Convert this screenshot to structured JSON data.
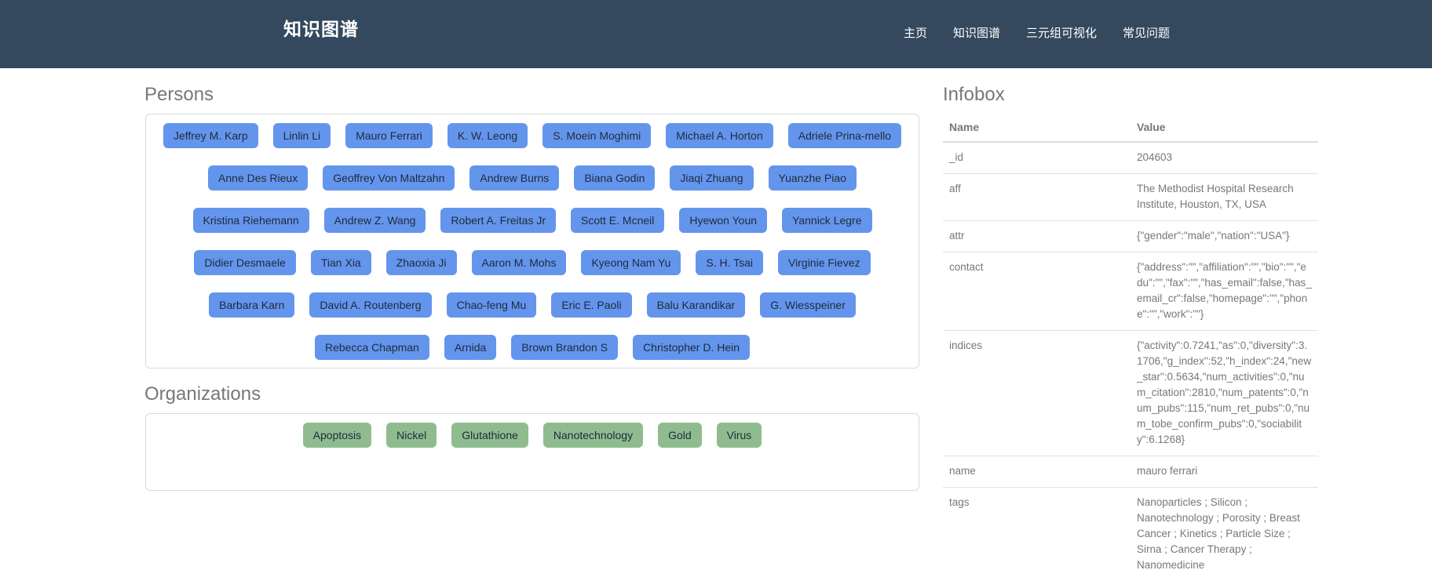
{
  "navbar": {
    "brand": "知识图谱",
    "links": [
      "主页",
      "知识图谱",
      "三元组可视化",
      "常见问题"
    ]
  },
  "persons": {
    "title": "Persons",
    "rows": [
      [
        "Jeffrey M. Karp",
        "Linlin Li",
        "Mauro Ferrari",
        "K. W. Leong",
        "S. Moein Moghimi",
        "Michael A. Horton",
        "Adriele Prina-mello"
      ],
      [
        "Anne Des Rieux",
        "Geoffrey Von Maltzahn",
        "Andrew Burns",
        "Biana Godin",
        "Jiaqi Zhuang",
        "Yuanzhe Piao"
      ],
      [
        "Kristina Riehemann",
        "Andrew Z. Wang",
        "Robert A. Freitas Jr",
        "Scott E. Mcneil",
        "Hyewon Youn",
        "Yannick Legre"
      ],
      [
        "Didier Desmaele",
        "Tian Xia",
        "Zhaoxia Ji",
        "Aaron M. Mohs",
        "Kyeong Nam Yu",
        "S. H. Tsai",
        "Virginie Fievez"
      ],
      [
        "Barbara Karn",
        "David A. Routenberg",
        "Chao-feng Mu",
        "Eric E. Paoli",
        "Balu Karandikar",
        "G. Wiesspeiner"
      ],
      [
        "Rebecca Chapman",
        "Arnida",
        "Brown Brandon S",
        "Christopher D. Hein"
      ]
    ]
  },
  "organizations": {
    "title": "Organizations",
    "items": [
      "Apoptosis",
      "Nickel",
      "Glutathione",
      "Nanotechnology",
      "Gold",
      "Virus"
    ]
  },
  "infobox": {
    "title": "Infobox",
    "header": {
      "name": "Name",
      "value": "Value"
    },
    "rows": [
      {
        "name": "_id",
        "value": "204603"
      },
      {
        "name": "aff",
        "value": "The Methodist Hospital Research Institute, Houston, TX, USA"
      },
      {
        "name": "attr",
        "value": "{\"gender\":\"male\",\"nation\":\"USA\"}"
      },
      {
        "name": "contact",
        "value": "{\"address\":\"\",\"affiliation\":\"\",\"bio\":\"\",\"edu\":\"\",\"fax\":\"\",\"has_email\":false,\"has_email_cr\":false,\"homepage\":\"\",\"phone\":\"\",\"work\":\"\"}"
      },
      {
        "name": "indices",
        "value": "{\"activity\":0.7241,\"as\":0,\"diversity\":3.1706,\"g_index\":52,\"h_index\":24,\"new_star\":0.5634,\"num_activities\":0,\"num_citation\":2810,\"num_patents\":0,\"num_pubs\":115,\"num_ret_pubs\":0,\"num_tobe_confirm_pubs\":0,\"sociability\":6.1268}"
      },
      {
        "name": "name",
        "value": "mauro ferrari"
      },
      {
        "name": "tags",
        "value": "Nanoparticles ; Silicon ; Nanotechnology ; Porosity ; Breast Cancer ; Kinetics ; Particle Size ; Sirna ; Cancer Therapy ; Nanomedicine"
      }
    ]
  }
}
